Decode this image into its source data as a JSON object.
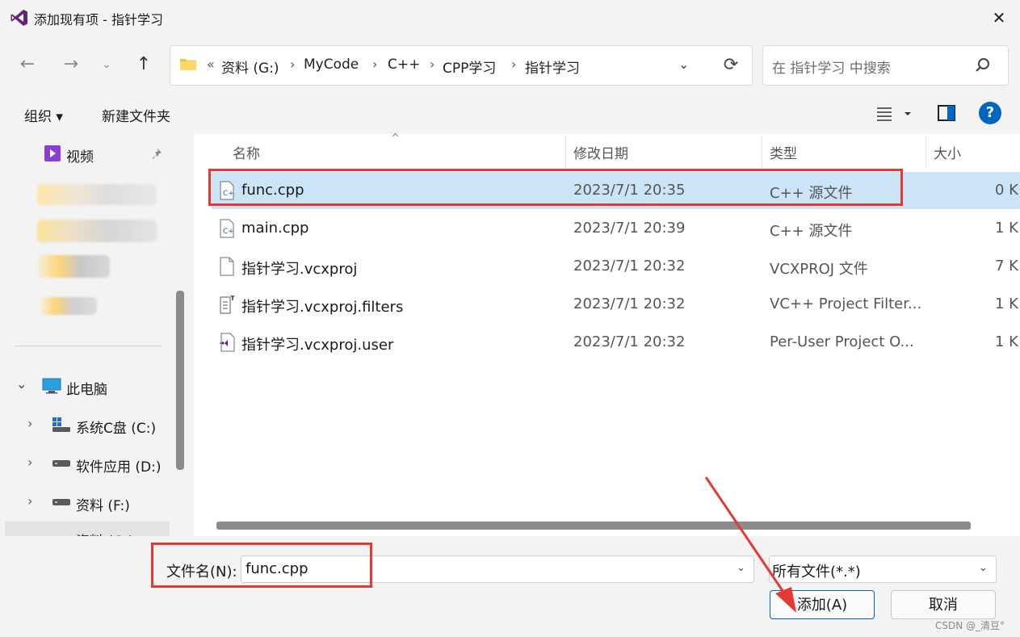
{
  "window": {
    "title": "添加现有项 - 指针学习",
    "close_glyph": "✕"
  },
  "nav": {
    "back_glyph": "←",
    "forward_glyph": "→",
    "recent_glyph": "⌄",
    "up_glyph": "↑",
    "breadcrumb_prefix": "«",
    "breadcrumb": [
      "资料 (G:)",
      "MyCode",
      "C++",
      "CPP学习",
      "指针学习"
    ],
    "separator": "›",
    "dropdown_glyph": "⌄",
    "refresh_glyph": "⟳"
  },
  "search": {
    "placeholder": "在 指针学习 中搜索"
  },
  "toolbar": {
    "organize": "组织 ▾",
    "new_folder": "新建文件夹",
    "help": "?"
  },
  "sidebar": {
    "videos": "视频",
    "this_pc": "此电脑",
    "this_pc_chevron": "⌄",
    "expand_chevron": "›",
    "drives": [
      "系统C盘 (C:)",
      "软件应用 (D:)",
      "资料 (F:)",
      "资料 (G:)"
    ]
  },
  "columns": {
    "name": "名称",
    "date": "修改日期",
    "type": "类型",
    "size": "大小",
    "sort_glyph": "^"
  },
  "files": [
    {
      "name": "func.cpp",
      "date": "2023/7/1 20:35",
      "type": "C++ 源文件",
      "size": "0 K",
      "icon": "cpp-file-icon",
      "selected": true
    },
    {
      "name": "main.cpp",
      "date": "2023/7/1 20:39",
      "type": "C++ 源文件",
      "size": "1 K",
      "icon": "cpp-file-icon",
      "selected": false
    },
    {
      "name": "指针学习.vcxproj",
      "date": "2023/7/1 20:32",
      "type": "VCXPROJ 文件",
      "size": "7 K",
      "icon": "blank-file-icon",
      "selected": false
    },
    {
      "name": "指针学习.vcxproj.filters",
      "date": "2023/7/1 20:32",
      "type": "VC++ Project Filter...",
      "size": "1 K",
      "icon": "filters-file-icon",
      "selected": false
    },
    {
      "name": "指针学习.vcxproj.user",
      "date": "2023/7/1 20:32",
      "type": "Per-User Project O...",
      "size": "1 K",
      "icon": "vs-user-file-icon",
      "selected": false
    }
  ],
  "bottom": {
    "filename_label": "文件名(N):",
    "filename_value": "func.cpp",
    "filetype_value": "所有文件(*.*)",
    "chevron": "⌄",
    "add_button": "添加(A)",
    "cancel_button": "取消"
  },
  "watermark": "CSDN @_清豆°",
  "colors": {
    "accent": "#0067c0",
    "selection": "#cce4f7",
    "annotation_red": "#e53935",
    "vs_purple": "#68217a"
  }
}
